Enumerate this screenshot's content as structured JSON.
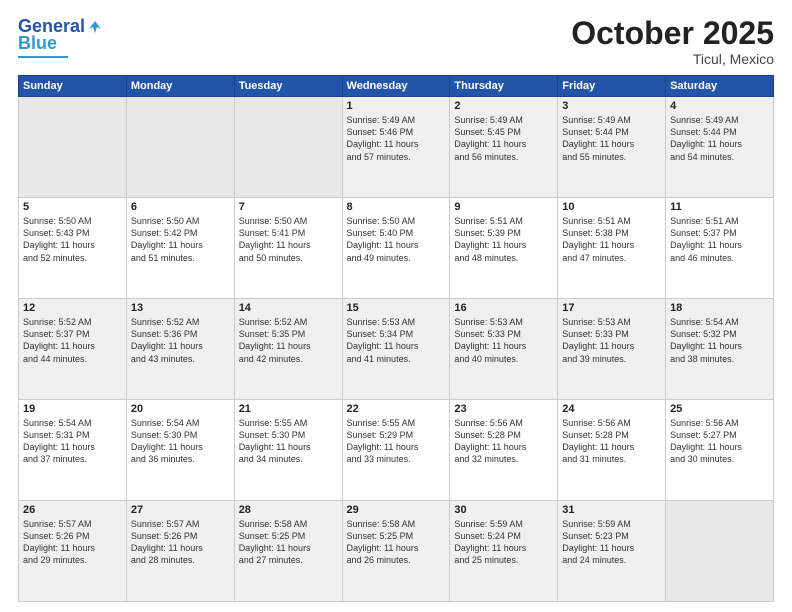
{
  "header": {
    "logo_general": "General",
    "logo_blue": "Blue",
    "month_title": "October 2025",
    "location": "Ticul, Mexico"
  },
  "days_of_week": [
    "Sunday",
    "Monday",
    "Tuesday",
    "Wednesday",
    "Thursday",
    "Friday",
    "Saturday"
  ],
  "weeks": [
    [
      {
        "day": "",
        "text": ""
      },
      {
        "day": "",
        "text": ""
      },
      {
        "day": "",
        "text": ""
      },
      {
        "day": "1",
        "text": "Sunrise: 5:49 AM\nSunset: 5:46 PM\nDaylight: 11 hours\nand 57 minutes."
      },
      {
        "day": "2",
        "text": "Sunrise: 5:49 AM\nSunset: 5:45 PM\nDaylight: 11 hours\nand 56 minutes."
      },
      {
        "day": "3",
        "text": "Sunrise: 5:49 AM\nSunset: 5:44 PM\nDaylight: 11 hours\nand 55 minutes."
      },
      {
        "day": "4",
        "text": "Sunrise: 5:49 AM\nSunset: 5:44 PM\nDaylight: 11 hours\nand 54 minutes."
      }
    ],
    [
      {
        "day": "5",
        "text": "Sunrise: 5:50 AM\nSunset: 5:43 PM\nDaylight: 11 hours\nand 52 minutes."
      },
      {
        "day": "6",
        "text": "Sunrise: 5:50 AM\nSunset: 5:42 PM\nDaylight: 11 hours\nand 51 minutes."
      },
      {
        "day": "7",
        "text": "Sunrise: 5:50 AM\nSunset: 5:41 PM\nDaylight: 11 hours\nand 50 minutes."
      },
      {
        "day": "8",
        "text": "Sunrise: 5:50 AM\nSunset: 5:40 PM\nDaylight: 11 hours\nand 49 minutes."
      },
      {
        "day": "9",
        "text": "Sunrise: 5:51 AM\nSunset: 5:39 PM\nDaylight: 11 hours\nand 48 minutes."
      },
      {
        "day": "10",
        "text": "Sunrise: 5:51 AM\nSunset: 5:38 PM\nDaylight: 11 hours\nand 47 minutes."
      },
      {
        "day": "11",
        "text": "Sunrise: 5:51 AM\nSunset: 5:37 PM\nDaylight: 11 hours\nand 46 minutes."
      }
    ],
    [
      {
        "day": "12",
        "text": "Sunrise: 5:52 AM\nSunset: 5:37 PM\nDaylight: 11 hours\nand 44 minutes."
      },
      {
        "day": "13",
        "text": "Sunrise: 5:52 AM\nSunset: 5:36 PM\nDaylight: 11 hours\nand 43 minutes."
      },
      {
        "day": "14",
        "text": "Sunrise: 5:52 AM\nSunset: 5:35 PM\nDaylight: 11 hours\nand 42 minutes."
      },
      {
        "day": "15",
        "text": "Sunrise: 5:53 AM\nSunset: 5:34 PM\nDaylight: 11 hours\nand 41 minutes."
      },
      {
        "day": "16",
        "text": "Sunrise: 5:53 AM\nSunset: 5:33 PM\nDaylight: 11 hours\nand 40 minutes."
      },
      {
        "day": "17",
        "text": "Sunrise: 5:53 AM\nSunset: 5:33 PM\nDaylight: 11 hours\nand 39 minutes."
      },
      {
        "day": "18",
        "text": "Sunrise: 5:54 AM\nSunset: 5:32 PM\nDaylight: 11 hours\nand 38 minutes."
      }
    ],
    [
      {
        "day": "19",
        "text": "Sunrise: 5:54 AM\nSunset: 5:31 PM\nDaylight: 11 hours\nand 37 minutes."
      },
      {
        "day": "20",
        "text": "Sunrise: 5:54 AM\nSunset: 5:30 PM\nDaylight: 11 hours\nand 36 minutes."
      },
      {
        "day": "21",
        "text": "Sunrise: 5:55 AM\nSunset: 5:30 PM\nDaylight: 11 hours\nand 34 minutes."
      },
      {
        "day": "22",
        "text": "Sunrise: 5:55 AM\nSunset: 5:29 PM\nDaylight: 11 hours\nand 33 minutes."
      },
      {
        "day": "23",
        "text": "Sunrise: 5:56 AM\nSunset: 5:28 PM\nDaylight: 11 hours\nand 32 minutes."
      },
      {
        "day": "24",
        "text": "Sunrise: 5:56 AM\nSunset: 5:28 PM\nDaylight: 11 hours\nand 31 minutes."
      },
      {
        "day": "25",
        "text": "Sunrise: 5:56 AM\nSunset: 5:27 PM\nDaylight: 11 hours\nand 30 minutes."
      }
    ],
    [
      {
        "day": "26",
        "text": "Sunrise: 5:57 AM\nSunset: 5:26 PM\nDaylight: 11 hours\nand 29 minutes."
      },
      {
        "day": "27",
        "text": "Sunrise: 5:57 AM\nSunset: 5:26 PM\nDaylight: 11 hours\nand 28 minutes."
      },
      {
        "day": "28",
        "text": "Sunrise: 5:58 AM\nSunset: 5:25 PM\nDaylight: 11 hours\nand 27 minutes."
      },
      {
        "day": "29",
        "text": "Sunrise: 5:58 AM\nSunset: 5:25 PM\nDaylight: 11 hours\nand 26 minutes."
      },
      {
        "day": "30",
        "text": "Sunrise: 5:59 AM\nSunset: 5:24 PM\nDaylight: 11 hours\nand 25 minutes."
      },
      {
        "day": "31",
        "text": "Sunrise: 5:59 AM\nSunset: 5:23 PM\nDaylight: 11 hours\nand 24 minutes."
      },
      {
        "day": "",
        "text": ""
      }
    ]
  ]
}
